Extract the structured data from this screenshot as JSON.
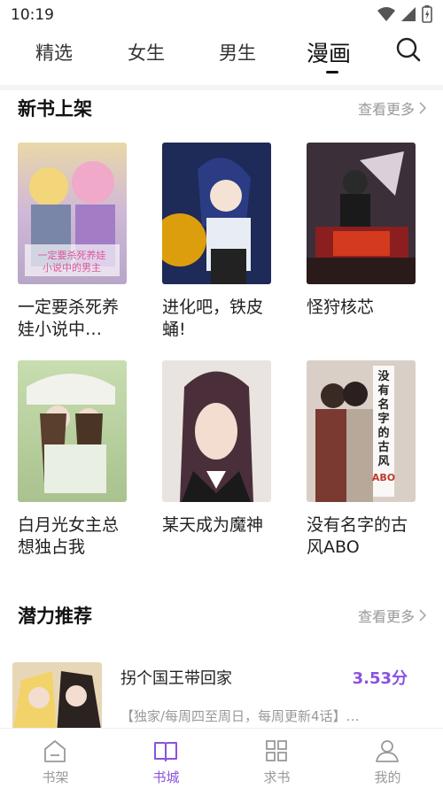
{
  "status": {
    "time": "10:19"
  },
  "tabs": [
    "精选",
    "女生",
    "男生",
    "漫画"
  ],
  "active_tab": "漫画",
  "section_new": {
    "title": "新书上架",
    "see_more": "查看更多",
    "books": [
      {
        "title": "一定要杀死养娃小说中…"
      },
      {
        "title": "进化吧，铁皮蛹!"
      },
      {
        "title": "怪狩核芯"
      },
      {
        "title": "白月光女主总想独占我"
      },
      {
        "title": "某天成为魔神"
      },
      {
        "title": "没有名字的古风ABO"
      }
    ]
  },
  "section_rec": {
    "title": "潜力推荐",
    "see_more": "查看更多",
    "item": {
      "title": "拐个国王带回家",
      "score": "3.53分",
      "desc": "【独家/每周四至周日，每周更新4话】…"
    }
  },
  "cover_texts": {
    "book1": "一定要杀死养娃小说中的男主",
    "book6_vertical": "没有名字的古风",
    "book6_abo": "ABO"
  },
  "nav": [
    {
      "label": "书架",
      "icon": "bookshelf-icon"
    },
    {
      "label": "书城",
      "icon": "open-book-icon"
    },
    {
      "label": "求书",
      "icon": "grid-icon"
    },
    {
      "label": "我的",
      "icon": "person-icon"
    }
  ],
  "colors": {
    "accent": "#8a52dd",
    "muted": "#999999"
  }
}
